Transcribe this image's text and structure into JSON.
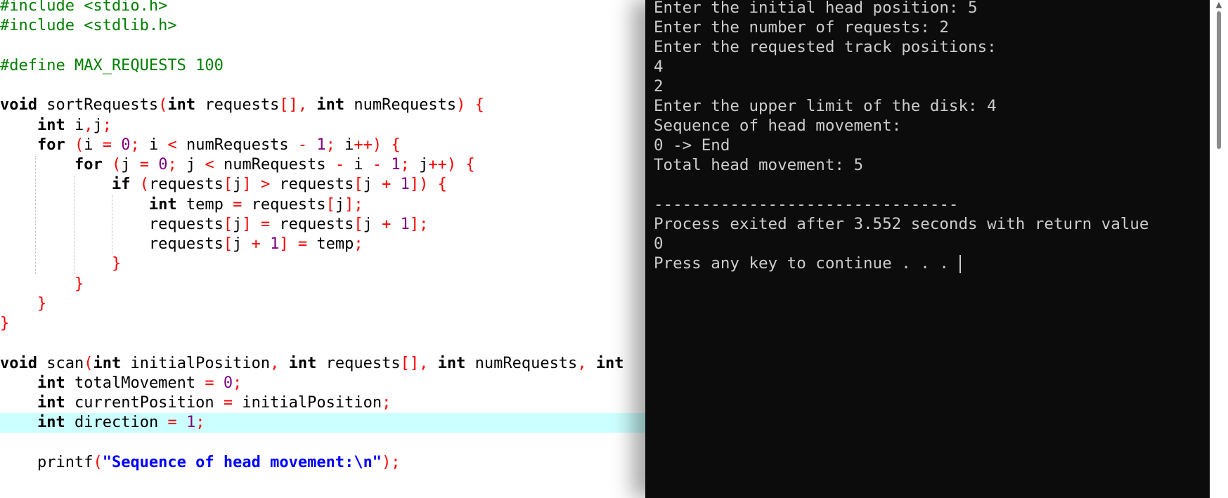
{
  "editor": {
    "lines": [
      {
        "tokens": [
          {
            "c": "pp",
            "t": "#include <stdio.h>"
          }
        ]
      },
      {
        "tokens": [
          {
            "c": "pp",
            "t": "#include <stdlib.h>"
          }
        ]
      },
      {
        "tokens": []
      },
      {
        "tokens": [
          {
            "c": "pp",
            "t": "#define MAX_REQUESTS 100"
          }
        ]
      },
      {
        "tokens": []
      },
      {
        "tokens": [
          {
            "c": "kw",
            "t": "void"
          },
          {
            "c": "id",
            "t": " sortRequests"
          },
          {
            "c": "op",
            "t": "("
          },
          {
            "c": "kw",
            "t": "int"
          },
          {
            "c": "id",
            "t": " requests"
          },
          {
            "c": "op",
            "t": "[],"
          },
          {
            "c": "id",
            "t": " "
          },
          {
            "c": "kw",
            "t": "int"
          },
          {
            "c": "id",
            "t": " numRequests"
          },
          {
            "c": "op",
            "t": ")"
          },
          {
            "c": "id",
            "t": " "
          },
          {
            "c": "op",
            "t": "{"
          }
        ]
      },
      {
        "tokens": [
          {
            "c": "id",
            "t": "    "
          },
          {
            "c": "kw",
            "t": "int"
          },
          {
            "c": "id",
            "t": " i"
          },
          {
            "c": "op",
            "t": ","
          },
          {
            "c": "id",
            "t": "j"
          },
          {
            "c": "op",
            "t": ";"
          }
        ]
      },
      {
        "tokens": [
          {
            "c": "id",
            "t": "    "
          },
          {
            "c": "kw",
            "t": "for"
          },
          {
            "c": "id",
            "t": " "
          },
          {
            "c": "op",
            "t": "("
          },
          {
            "c": "id",
            "t": "i "
          },
          {
            "c": "op",
            "t": "="
          },
          {
            "c": "id",
            "t": " "
          },
          {
            "c": "num",
            "t": "0"
          },
          {
            "c": "op",
            "t": ";"
          },
          {
            "c": "id",
            "t": " i "
          },
          {
            "c": "op",
            "t": "<"
          },
          {
            "c": "id",
            "t": " numRequests "
          },
          {
            "c": "op",
            "t": "-"
          },
          {
            "c": "id",
            "t": " "
          },
          {
            "c": "num",
            "t": "1"
          },
          {
            "c": "op",
            "t": ";"
          },
          {
            "c": "id",
            "t": " i"
          },
          {
            "c": "op",
            "t": "++)"
          },
          {
            "c": "id",
            "t": " "
          },
          {
            "c": "op",
            "t": "{"
          }
        ]
      },
      {
        "tokens": [
          {
            "c": "id",
            "t": "        "
          },
          {
            "c": "kw",
            "t": "for"
          },
          {
            "c": "id",
            "t": " "
          },
          {
            "c": "op",
            "t": "("
          },
          {
            "c": "id",
            "t": "j "
          },
          {
            "c": "op",
            "t": "="
          },
          {
            "c": "id",
            "t": " "
          },
          {
            "c": "num",
            "t": "0"
          },
          {
            "c": "op",
            "t": ";"
          },
          {
            "c": "id",
            "t": " j "
          },
          {
            "c": "op",
            "t": "<"
          },
          {
            "c": "id",
            "t": " numRequests "
          },
          {
            "c": "op",
            "t": "-"
          },
          {
            "c": "id",
            "t": " i "
          },
          {
            "c": "op",
            "t": "-"
          },
          {
            "c": "id",
            "t": " "
          },
          {
            "c": "num",
            "t": "1"
          },
          {
            "c": "op",
            "t": ";"
          },
          {
            "c": "id",
            "t": " j"
          },
          {
            "c": "op",
            "t": "++)"
          },
          {
            "c": "id",
            "t": " "
          },
          {
            "c": "op",
            "t": "{"
          }
        ]
      },
      {
        "tokens": [
          {
            "c": "id",
            "t": "            "
          },
          {
            "c": "kw",
            "t": "if"
          },
          {
            "c": "id",
            "t": " "
          },
          {
            "c": "op",
            "t": "("
          },
          {
            "c": "id",
            "t": "requests"
          },
          {
            "c": "op",
            "t": "["
          },
          {
            "c": "id",
            "t": "j"
          },
          {
            "c": "op",
            "t": "]"
          },
          {
            "c": "id",
            "t": " "
          },
          {
            "c": "op",
            "t": ">"
          },
          {
            "c": "id",
            "t": " requests"
          },
          {
            "c": "op",
            "t": "["
          },
          {
            "c": "id",
            "t": "j "
          },
          {
            "c": "op",
            "t": "+"
          },
          {
            "c": "id",
            "t": " "
          },
          {
            "c": "num",
            "t": "1"
          },
          {
            "c": "op",
            "t": "])"
          },
          {
            "c": "id",
            "t": " "
          },
          {
            "c": "op",
            "t": "{"
          }
        ]
      },
      {
        "tokens": [
          {
            "c": "id",
            "t": "                "
          },
          {
            "c": "kw",
            "t": "int"
          },
          {
            "c": "id",
            "t": " temp "
          },
          {
            "c": "op",
            "t": "="
          },
          {
            "c": "id",
            "t": " requests"
          },
          {
            "c": "op",
            "t": "["
          },
          {
            "c": "id",
            "t": "j"
          },
          {
            "c": "op",
            "t": "];"
          }
        ]
      },
      {
        "tokens": [
          {
            "c": "id",
            "t": "                requests"
          },
          {
            "c": "op",
            "t": "["
          },
          {
            "c": "id",
            "t": "j"
          },
          {
            "c": "op",
            "t": "]"
          },
          {
            "c": "id",
            "t": " "
          },
          {
            "c": "op",
            "t": "="
          },
          {
            "c": "id",
            "t": " requests"
          },
          {
            "c": "op",
            "t": "["
          },
          {
            "c": "id",
            "t": "j "
          },
          {
            "c": "op",
            "t": "+"
          },
          {
            "c": "id",
            "t": " "
          },
          {
            "c": "num",
            "t": "1"
          },
          {
            "c": "op",
            "t": "];"
          }
        ]
      },
      {
        "tokens": [
          {
            "c": "id",
            "t": "                requests"
          },
          {
            "c": "op",
            "t": "["
          },
          {
            "c": "id",
            "t": "j "
          },
          {
            "c": "op",
            "t": "+"
          },
          {
            "c": "id",
            "t": " "
          },
          {
            "c": "num",
            "t": "1"
          },
          {
            "c": "op",
            "t": "]"
          },
          {
            "c": "id",
            "t": " "
          },
          {
            "c": "op",
            "t": "="
          },
          {
            "c": "id",
            "t": " temp"
          },
          {
            "c": "op",
            "t": ";"
          }
        ]
      },
      {
        "tokens": [
          {
            "c": "id",
            "t": "            "
          },
          {
            "c": "op",
            "t": "}"
          }
        ]
      },
      {
        "tokens": [
          {
            "c": "id",
            "t": "        "
          },
          {
            "c": "op",
            "t": "}"
          }
        ]
      },
      {
        "tokens": [
          {
            "c": "id",
            "t": "    "
          },
          {
            "c": "op",
            "t": "}"
          }
        ]
      },
      {
        "tokens": [
          {
            "c": "op",
            "t": "}"
          }
        ]
      },
      {
        "tokens": []
      },
      {
        "tokens": [
          {
            "c": "kw",
            "t": "void"
          },
          {
            "c": "id",
            "t": " scan"
          },
          {
            "c": "op",
            "t": "("
          },
          {
            "c": "kw",
            "t": "int"
          },
          {
            "c": "id",
            "t": " initialPosition"
          },
          {
            "c": "op",
            "t": ","
          },
          {
            "c": "id",
            "t": " "
          },
          {
            "c": "kw",
            "t": "int"
          },
          {
            "c": "id",
            "t": " requests"
          },
          {
            "c": "op",
            "t": "[],"
          },
          {
            "c": "id",
            "t": " "
          },
          {
            "c": "kw",
            "t": "int"
          },
          {
            "c": "id",
            "t": " numRequests"
          },
          {
            "c": "op",
            "t": ","
          },
          {
            "c": "id",
            "t": " "
          },
          {
            "c": "kw",
            "t": "int"
          }
        ]
      },
      {
        "tokens": [
          {
            "c": "id",
            "t": "    "
          },
          {
            "c": "kw",
            "t": "int"
          },
          {
            "c": "id",
            "t": " totalMovement "
          },
          {
            "c": "op",
            "t": "="
          },
          {
            "c": "id",
            "t": " "
          },
          {
            "c": "num",
            "t": "0"
          },
          {
            "c": "op",
            "t": ";"
          }
        ]
      },
      {
        "tokens": [
          {
            "c": "id",
            "t": "    "
          },
          {
            "c": "kw",
            "t": "int"
          },
          {
            "c": "id",
            "t": " currentPosition "
          },
          {
            "c": "op",
            "t": "="
          },
          {
            "c": "id",
            "t": " initialPosition"
          },
          {
            "c": "op",
            "t": ";"
          }
        ]
      },
      {
        "current": true,
        "tokens": [
          {
            "c": "id",
            "t": "    "
          },
          {
            "c": "kw",
            "t": "int"
          },
          {
            "c": "id",
            "t": " direction "
          },
          {
            "c": "op",
            "t": "="
          },
          {
            "c": "id",
            "t": " "
          },
          {
            "c": "num",
            "t": "1"
          },
          {
            "c": "op",
            "t": ";"
          }
        ]
      },
      {
        "tokens": []
      },
      {
        "tokens": [
          {
            "c": "id",
            "t": "    printf"
          },
          {
            "c": "op",
            "t": "("
          },
          {
            "c": "str",
            "t": "\"Sequence of head movement:\\n\""
          },
          {
            "c": "op",
            "t": ");"
          }
        ]
      }
    ]
  },
  "console": {
    "lines": [
      "Enter the initial head position: 5",
      "Enter the number of requests: 2",
      "Enter the requested track positions:",
      "4",
      "2",
      "Enter the upper limit of the disk: 4",
      "Sequence of head movement:",
      "0 -> End",
      "Total head movement: 5",
      "",
      "--------------------------------",
      "Process exited after 3.552 seconds with return value",
      "0",
      "Press any key to continue . . . "
    ],
    "cursor_line": 13,
    "scroll_up_glyph": "▲",
    "colors": {
      "background": "#0c0c0c",
      "text": "#cccccc"
    }
  },
  "editor_colors": {
    "keyword": "#000000",
    "preprocessor": "#008000",
    "number": "#800080",
    "operator": "#ff0000",
    "string": "#0000ff",
    "current_line": "#ccffff"
  }
}
